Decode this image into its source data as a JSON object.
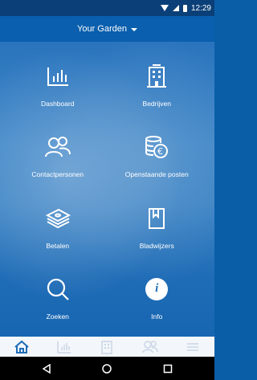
{
  "status_bar": {
    "time": "12:29",
    "icons": [
      "wifi-icon",
      "signal-icon",
      "battery-icon"
    ]
  },
  "app_bar": {
    "title": "Your Garden",
    "dropdown_icon": "caret-down-icon"
  },
  "menu": {
    "items": [
      {
        "id": "dashboard",
        "label": "Dashboard",
        "icon": "bar-chart-icon"
      },
      {
        "id": "bedrijven",
        "label": "Bedrijven",
        "icon": "building-icon"
      },
      {
        "id": "contactpersonen",
        "label": "Contactpersonen",
        "icon": "people-icon"
      },
      {
        "id": "openstaande_posten",
        "label": "Openstaande posten",
        "icon": "coins-euro-icon"
      },
      {
        "id": "betalen",
        "label": "Betalen",
        "icon": "money-stack-icon"
      },
      {
        "id": "bladwijzers",
        "label": "Bladwijzers",
        "icon": "bookmark-icon"
      },
      {
        "id": "zoeken",
        "label": "Zoeken",
        "icon": "search-icon"
      },
      {
        "id": "info",
        "label": "Info",
        "icon": "info-icon",
        "glyph": "i"
      }
    ]
  },
  "tab_bar": {
    "tabs": [
      {
        "name": "home",
        "icon": "home-icon",
        "active": true
      },
      {
        "name": "dashboard",
        "icon": "bar-chart-icon",
        "active": false
      },
      {
        "name": "bedrijven",
        "icon": "building-icon",
        "active": false
      },
      {
        "name": "contactpersonen",
        "icon": "people-icon",
        "active": false
      },
      {
        "name": "menu",
        "icon": "hamburger-icon",
        "active": false
      }
    ],
    "active_color": "#1f6cb6",
    "inactive_color": "#c9d6e6"
  },
  "colors": {
    "statusbar": "#0b3f78",
    "appbar": "#0a5fae",
    "accent": "#1f6cb6"
  }
}
